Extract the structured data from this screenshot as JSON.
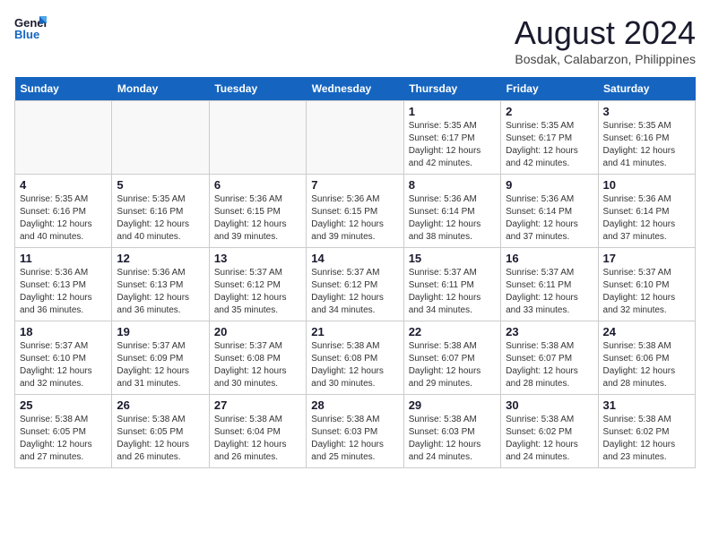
{
  "logo": {
    "line1": "General",
    "line2": "Blue"
  },
  "title": "August 2024",
  "subtitle": "Bosdak, Calabarzon, Philippines",
  "days_header": [
    "Sunday",
    "Monday",
    "Tuesday",
    "Wednesday",
    "Thursday",
    "Friday",
    "Saturday"
  ],
  "weeks": [
    [
      {
        "day": "",
        "info": ""
      },
      {
        "day": "",
        "info": ""
      },
      {
        "day": "",
        "info": ""
      },
      {
        "day": "",
        "info": ""
      },
      {
        "day": "1",
        "info": "Sunrise: 5:35 AM\nSunset: 6:17 PM\nDaylight: 12 hours\nand 42 minutes."
      },
      {
        "day": "2",
        "info": "Sunrise: 5:35 AM\nSunset: 6:17 PM\nDaylight: 12 hours\nand 42 minutes."
      },
      {
        "day": "3",
        "info": "Sunrise: 5:35 AM\nSunset: 6:16 PM\nDaylight: 12 hours\nand 41 minutes."
      }
    ],
    [
      {
        "day": "4",
        "info": "Sunrise: 5:35 AM\nSunset: 6:16 PM\nDaylight: 12 hours\nand 40 minutes."
      },
      {
        "day": "5",
        "info": "Sunrise: 5:35 AM\nSunset: 6:16 PM\nDaylight: 12 hours\nand 40 minutes."
      },
      {
        "day": "6",
        "info": "Sunrise: 5:36 AM\nSunset: 6:15 PM\nDaylight: 12 hours\nand 39 minutes."
      },
      {
        "day": "7",
        "info": "Sunrise: 5:36 AM\nSunset: 6:15 PM\nDaylight: 12 hours\nand 39 minutes."
      },
      {
        "day": "8",
        "info": "Sunrise: 5:36 AM\nSunset: 6:14 PM\nDaylight: 12 hours\nand 38 minutes."
      },
      {
        "day": "9",
        "info": "Sunrise: 5:36 AM\nSunset: 6:14 PM\nDaylight: 12 hours\nand 37 minutes."
      },
      {
        "day": "10",
        "info": "Sunrise: 5:36 AM\nSunset: 6:14 PM\nDaylight: 12 hours\nand 37 minutes."
      }
    ],
    [
      {
        "day": "11",
        "info": "Sunrise: 5:36 AM\nSunset: 6:13 PM\nDaylight: 12 hours\nand 36 minutes."
      },
      {
        "day": "12",
        "info": "Sunrise: 5:36 AM\nSunset: 6:13 PM\nDaylight: 12 hours\nand 36 minutes."
      },
      {
        "day": "13",
        "info": "Sunrise: 5:37 AM\nSunset: 6:12 PM\nDaylight: 12 hours\nand 35 minutes."
      },
      {
        "day": "14",
        "info": "Sunrise: 5:37 AM\nSunset: 6:12 PM\nDaylight: 12 hours\nand 34 minutes."
      },
      {
        "day": "15",
        "info": "Sunrise: 5:37 AM\nSunset: 6:11 PM\nDaylight: 12 hours\nand 34 minutes."
      },
      {
        "day": "16",
        "info": "Sunrise: 5:37 AM\nSunset: 6:11 PM\nDaylight: 12 hours\nand 33 minutes."
      },
      {
        "day": "17",
        "info": "Sunrise: 5:37 AM\nSunset: 6:10 PM\nDaylight: 12 hours\nand 32 minutes."
      }
    ],
    [
      {
        "day": "18",
        "info": "Sunrise: 5:37 AM\nSunset: 6:10 PM\nDaylight: 12 hours\nand 32 minutes."
      },
      {
        "day": "19",
        "info": "Sunrise: 5:37 AM\nSunset: 6:09 PM\nDaylight: 12 hours\nand 31 minutes."
      },
      {
        "day": "20",
        "info": "Sunrise: 5:37 AM\nSunset: 6:08 PM\nDaylight: 12 hours\nand 30 minutes."
      },
      {
        "day": "21",
        "info": "Sunrise: 5:38 AM\nSunset: 6:08 PM\nDaylight: 12 hours\nand 30 minutes."
      },
      {
        "day": "22",
        "info": "Sunrise: 5:38 AM\nSunset: 6:07 PM\nDaylight: 12 hours\nand 29 minutes."
      },
      {
        "day": "23",
        "info": "Sunrise: 5:38 AM\nSunset: 6:07 PM\nDaylight: 12 hours\nand 28 minutes."
      },
      {
        "day": "24",
        "info": "Sunrise: 5:38 AM\nSunset: 6:06 PM\nDaylight: 12 hours\nand 28 minutes."
      }
    ],
    [
      {
        "day": "25",
        "info": "Sunrise: 5:38 AM\nSunset: 6:05 PM\nDaylight: 12 hours\nand 27 minutes."
      },
      {
        "day": "26",
        "info": "Sunrise: 5:38 AM\nSunset: 6:05 PM\nDaylight: 12 hours\nand 26 minutes."
      },
      {
        "day": "27",
        "info": "Sunrise: 5:38 AM\nSunset: 6:04 PM\nDaylight: 12 hours\nand 26 minutes."
      },
      {
        "day": "28",
        "info": "Sunrise: 5:38 AM\nSunset: 6:03 PM\nDaylight: 12 hours\nand 25 minutes."
      },
      {
        "day": "29",
        "info": "Sunrise: 5:38 AM\nSunset: 6:03 PM\nDaylight: 12 hours\nand 24 minutes."
      },
      {
        "day": "30",
        "info": "Sunrise: 5:38 AM\nSunset: 6:02 PM\nDaylight: 12 hours\nand 24 minutes."
      },
      {
        "day": "31",
        "info": "Sunrise: 5:38 AM\nSunset: 6:02 PM\nDaylight: 12 hours\nand 23 minutes."
      }
    ]
  ]
}
